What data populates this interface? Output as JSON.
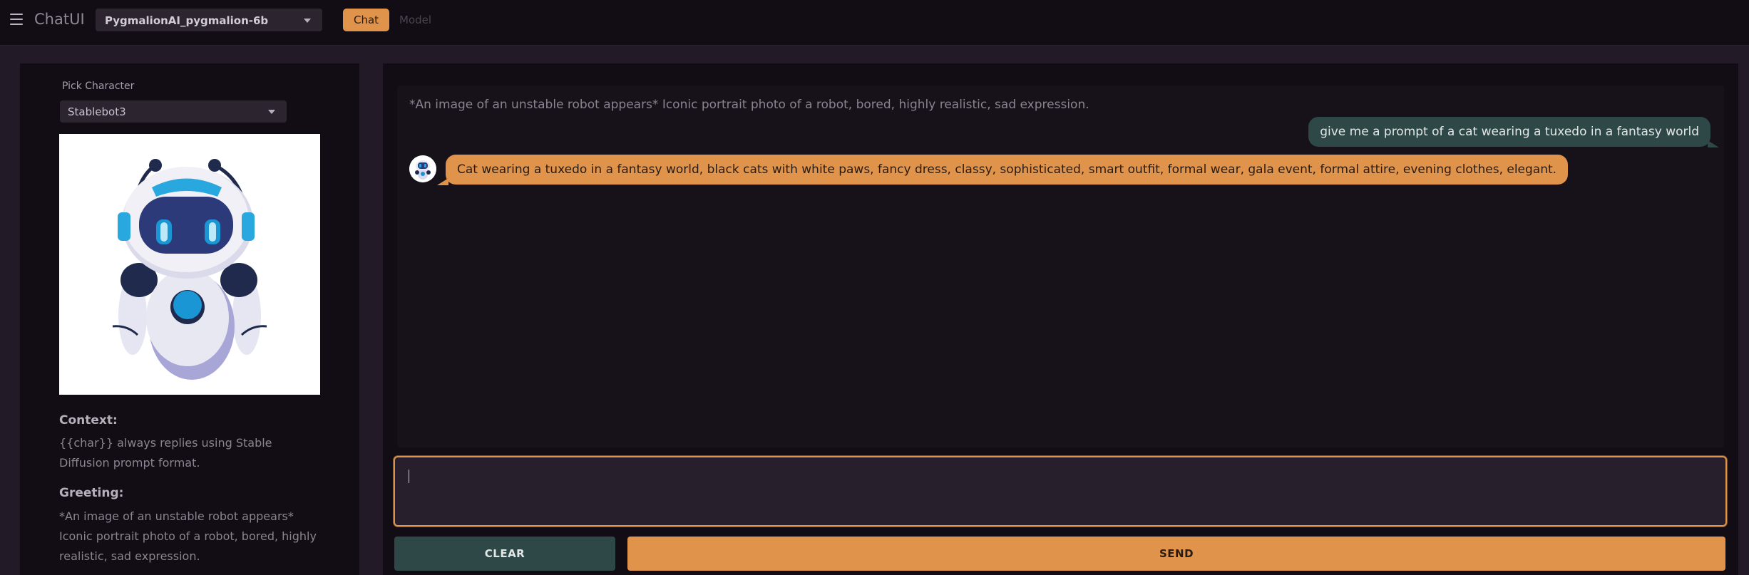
{
  "header": {
    "app_title": "ChatUI",
    "model_select_value": "PygmalionAI_pygmalion-6b",
    "tabs": [
      {
        "label": "Chat",
        "active": true
      },
      {
        "label": "Model",
        "active": false
      }
    ]
  },
  "sidebar": {
    "pick_label": "Pick Character",
    "character_select_value": "Stablebot3",
    "avatar_icon": "robot-avatar",
    "context_heading": "Context:",
    "context_text": "{{char}} always replies using Stable Diffusion prompt format.",
    "greeting_heading": "Greeting:",
    "greeting_text": "*An image of an unstable robot appears* Iconic portrait photo of a robot, bored, highly realistic, sad expression."
  },
  "chat": {
    "greeting_message": "*An image of an unstable robot appears* Iconic portrait photo of a robot, bored, highly realistic, sad expression.",
    "messages": [
      {
        "role": "user",
        "text": "give me a prompt of a cat wearing a tuxedo in a fantasy world"
      },
      {
        "role": "bot",
        "text": "Cat wearing a tuxedo in a fantasy world, black cats with white paws, fancy dress, classy, sophisticated, smart outfit, formal wear, gala event, formal attire, evening clothes, elegant."
      }
    ],
    "input_value": "",
    "clear_label": "CLEAR",
    "send_label": "SEND"
  },
  "colors": {
    "accent": "#e0934a",
    "user_bubble": "#2e4848",
    "background": "#221b27",
    "panel": "#120d14"
  }
}
